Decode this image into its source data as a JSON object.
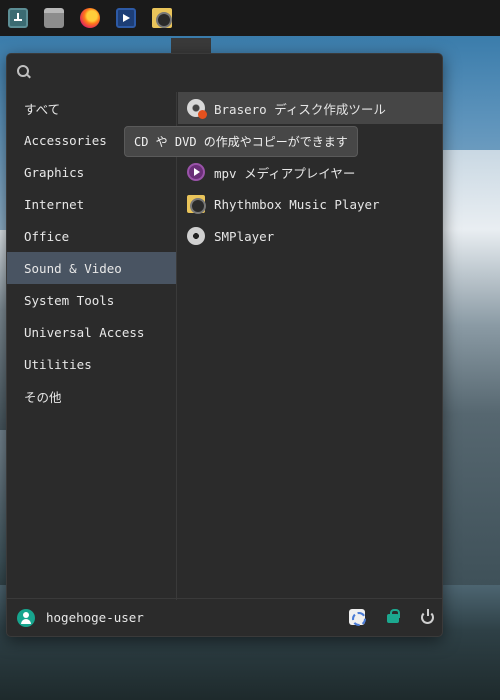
{
  "taskbar": {
    "launchers": [
      {
        "name": "app-grid-icon"
      },
      {
        "name": "download-icon"
      },
      {
        "name": "archive-icon"
      },
      {
        "name": "firefox-icon"
      },
      {
        "name": "video-player-icon"
      },
      {
        "name": "speaker-icon"
      }
    ]
  },
  "menu": {
    "search": {
      "placeholder": ""
    },
    "categories": [
      {
        "label": "すべて"
      },
      {
        "label": "Accessories"
      },
      {
        "label": "Graphics"
      },
      {
        "label": "Internet"
      },
      {
        "label": "Office"
      },
      {
        "label": "Sound & Video",
        "active": true
      },
      {
        "label": "System Tools"
      },
      {
        "label": "Universal Access"
      },
      {
        "label": "Utilities"
      },
      {
        "label": "その他"
      }
    ],
    "apps": [
      {
        "label": "Brasero ディスク作成ツール",
        "icon": "brasero-icon"
      },
      {
        "label": "mpv メディアプレイヤー",
        "icon": "mpv-icon"
      },
      {
        "label": "Rhythmbox Music Player",
        "icon": "rhythmbox-icon"
      },
      {
        "label": "SMPlayer",
        "icon": "smplayer-icon"
      }
    ],
    "tooltip": "CD や DVD の作成やコピーができます",
    "user": {
      "name": "hogehoge-user"
    }
  },
  "colors": {
    "panel": "#1a1a1a",
    "menu_bg": "#2b2b2b",
    "active_category": "#495462",
    "avatar": "#17a58e"
  }
}
